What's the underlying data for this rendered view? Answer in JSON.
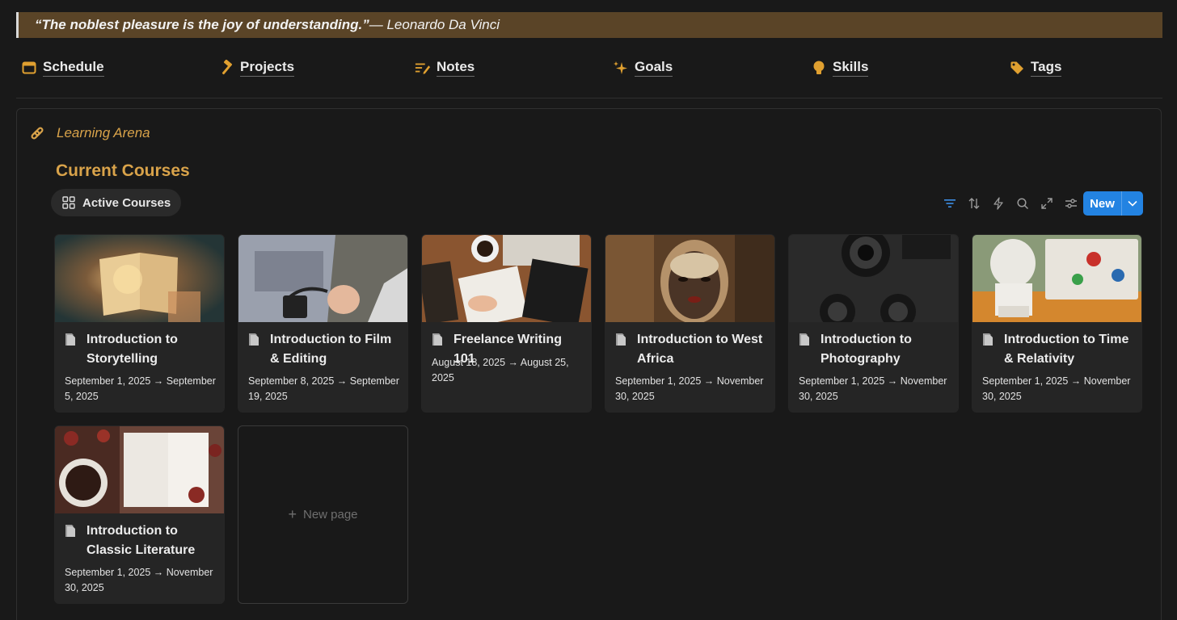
{
  "quote": {
    "text": "“The noblest pleasure is the joy of understanding.”",
    "author": " — Leonardo Da Vinci"
  },
  "nav": [
    {
      "label": "Schedule",
      "icon": "calendar-icon"
    },
    {
      "label": "Projects",
      "icon": "hammer-icon"
    },
    {
      "label": "Notes",
      "icon": "notes-icon"
    },
    {
      "label": "Goals",
      "icon": "sparkles-icon"
    },
    {
      "label": "Skills",
      "icon": "lightbulb-icon"
    },
    {
      "label": "Tags",
      "icon": "tag-icon"
    }
  ],
  "arena": {
    "label": "Learning Arena",
    "icon": "link-icon"
  },
  "section": {
    "title": "Current Courses"
  },
  "view": {
    "label": "Active Courses",
    "icon": "gallery-icon"
  },
  "toolbar": {
    "new_label": "New",
    "icons": [
      "filter-icon",
      "sort-icon",
      "automation-icon",
      "search-icon",
      "expand-icon",
      "settings-icon",
      "chevron-down-icon"
    ]
  },
  "colors": {
    "accent": "#d9a34a",
    "quote_bg": "#5a4427",
    "primary": "#2383e2",
    "bg": "#191919",
    "card": "#252525"
  },
  "courses": [
    {
      "title": "Introduction to Storytelling",
      "title_lines": [
        "Introduction to",
        "Storytelling"
      ],
      "date_lines": [
        "September 1, 2025 → September",
        "5, 2025"
      ],
      "image": "open-book-lights-image"
    },
    {
      "title": "Introduction to Film & Editing",
      "title_lines": [
        "Introduction to Film",
        "& Editing"
      ],
      "date_lines": [
        "September 8, 2025 → September",
        "19, 2025"
      ],
      "image": "laptop-editing-image"
    },
    {
      "title": "Freelance Writing 101",
      "title_lines": [
        "Freelance Writing 101"
      ],
      "date_lines": [
        "August 18, 2025 → August 25,",
        "2025"
      ],
      "image": "desk-writing-image"
    },
    {
      "title": "Introduction to West Africa",
      "title_lines": [
        "Introduction to West",
        "Africa"
      ],
      "date_lines": [
        "September 1, 2025 → November",
        "30, 2025"
      ],
      "image": "african-mask-image"
    },
    {
      "title": "Introduction to Photography",
      "title_lines": [
        "Introduction to",
        "Photography"
      ],
      "date_lines": [
        "September 1, 2025 → November",
        "30, 2025"
      ],
      "image": "camera-lenses-image"
    },
    {
      "title": "Introduction to Time & Relativity",
      "title_lines": [
        "Introduction to Time",
        "& Relativity"
      ],
      "date_lines": [
        "September 1, 2025 → November",
        "30, 2025"
      ],
      "image": "einstein-bust-image"
    },
    {
      "title": "Introduction to Classic Literature",
      "title_lines": [
        "Introduction to",
        "Classic Literature"
      ],
      "date_lines": [
        "September 1, 2025 → November",
        "30, 2025"
      ],
      "image": "book-roses-image"
    }
  ],
  "new_page": {
    "label": "New page"
  }
}
